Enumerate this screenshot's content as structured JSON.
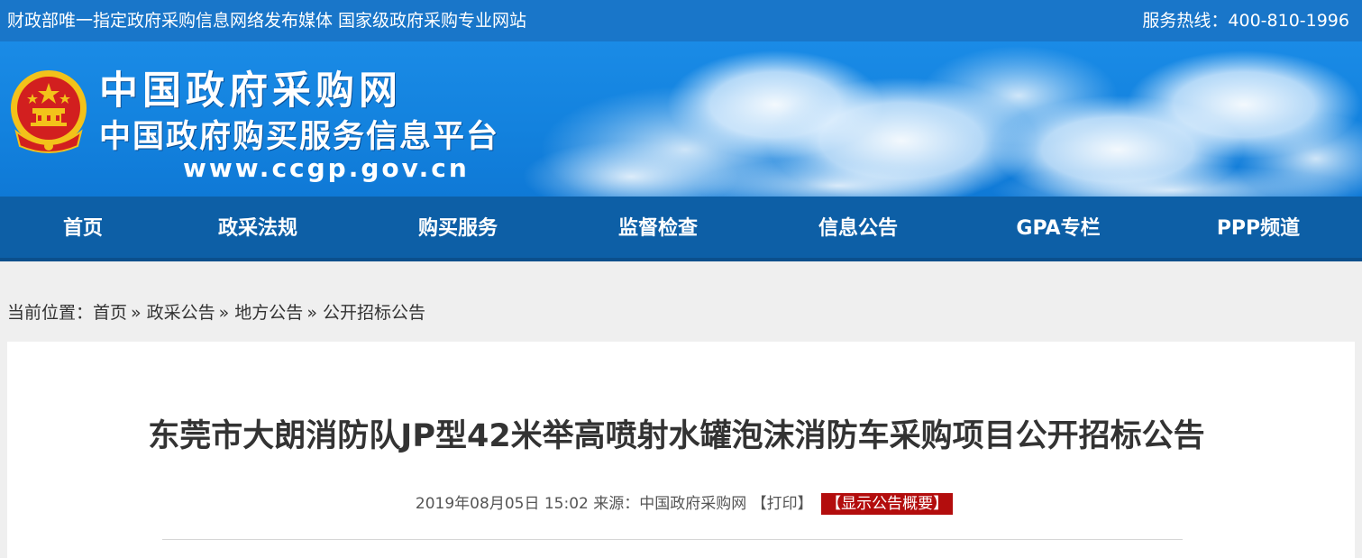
{
  "topbar": {
    "slogan": "财政部唯一指定政府采购信息网络发布媒体 国家级政府采购专业网站",
    "hotline": "服务热线：400-810-1996"
  },
  "banner": {
    "title": "中国政府采购网",
    "subtitle": "中国政府购买服务信息平台",
    "url": "www.ccgp.gov.cn",
    "emblem_icon": "national-emblem-icon",
    "colors": {
      "banner_blue": "#1382de",
      "topbar_blue": "#1976c9",
      "nav_blue": "#0d5fa6",
      "emblem_red": "#d21f1f",
      "emblem_gold": "#f3c21a"
    }
  },
  "nav": {
    "items": [
      {
        "label": "首页"
      },
      {
        "label": "政采法规"
      },
      {
        "label": "购买服务"
      },
      {
        "label": "监督检查"
      },
      {
        "label": "信息公告"
      },
      {
        "label": "GPA专栏"
      },
      {
        "label": "PPP频道"
      }
    ]
  },
  "breadcrumb": {
    "prefix": "当前位置：",
    "items": [
      "首页",
      "政采公告",
      "地方公告",
      "公开招标公告"
    ],
    "separator": "»"
  },
  "article": {
    "title": "东莞市大朗消防队JP型42米举高喷射水罐泡沫消防车采购项目公开招标公告",
    "date": "2019年08月05日 15:02",
    "source_label": "来源：",
    "source": "中国政府采购网",
    "print_label": "【打印】",
    "summary_label": "【显示公告概要】",
    "summary_color": "#b30d0d"
  }
}
